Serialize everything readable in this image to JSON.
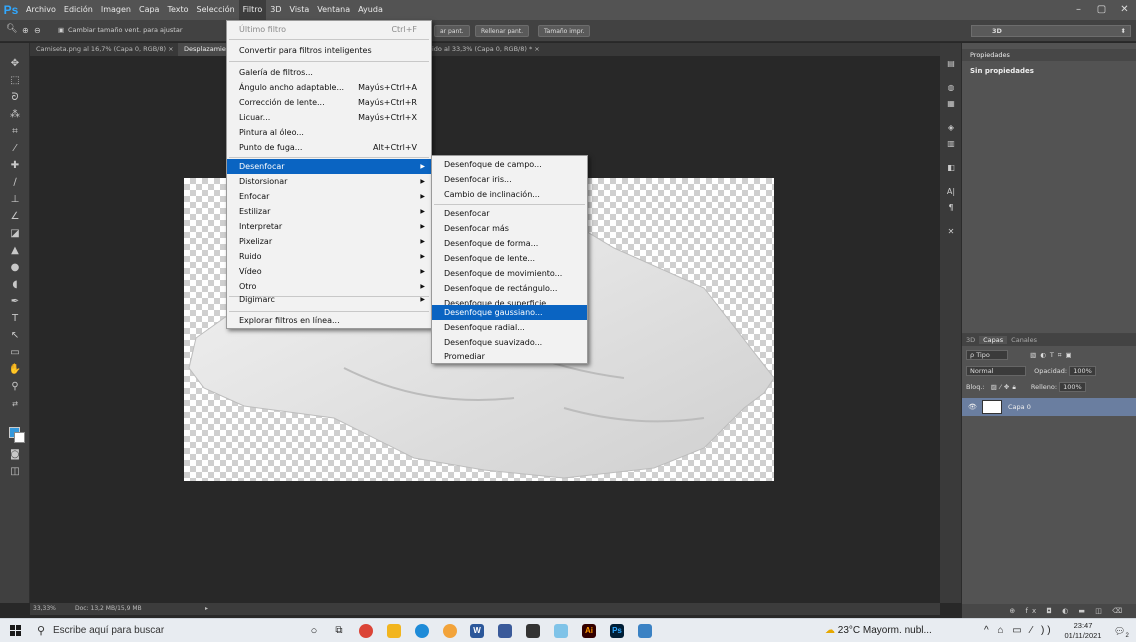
{
  "app": {
    "logo": "Ps"
  },
  "menubar": [
    "Archivo",
    "Edición",
    "Imagen",
    "Capa",
    "Texto",
    "Selección",
    "Filtro",
    "3D",
    "Vista",
    "Ventana",
    "Ayuda"
  ],
  "window_controls": [
    "–",
    "▢",
    "✕"
  ],
  "options": {
    "fit_window": "Cambiar tamaño vent. para ajustar",
    "btn_fill_screen_a": "ar pant.",
    "btn_fill_screen": "Rellenar pant.",
    "btn_print_size": "Tamaño impr.",
    "workspace": "3D"
  },
  "tabs": [
    {
      "label": "Camiseta.png al 16,7% (Capa 0, RGB/8) ×"
    },
    {
      "label": "Desplazamie"
    },
    {
      "label": "ido al 33,3% (Capa 0, RGB/8) * ×"
    }
  ],
  "filter_menu": {
    "last_filter": "Último filtro",
    "last_filter_sc": "Ctrl+F",
    "smart": "Convertir para filtros inteligentes",
    "gallery": "Galería de filtros...",
    "wide_angle": "Ángulo ancho adaptable...",
    "wide_angle_sc": "Mayús+Ctrl+A",
    "lens_corr": "Corrección de lente...",
    "lens_corr_sc": "Mayús+Ctrl+R",
    "liquify": "Licuar...",
    "liquify_sc": "Mayús+Ctrl+X",
    "oil": "Pintura al óleo...",
    "vanishing": "Punto de fuga...",
    "vanishing_sc": "Alt+Ctrl+V",
    "blur": "Desenfocar",
    "distort": "Distorsionar",
    "sharpen": "Enfocar",
    "stylize": "Estilizar",
    "render": "Interpretar",
    "pixelate": "Pixelizar",
    "noise": "Ruido",
    "video": "Vídeo",
    "other": "Otro",
    "digimarc": "Digimarc",
    "browse": "Explorar filtros en línea..."
  },
  "blur_menu": {
    "field": "Desenfoque de campo...",
    "iris": "Desenfocar iris...",
    "tilt": "Cambio de inclinación...",
    "blur": "Desenfocar",
    "blur_more": "Desenfocar más",
    "shape": "Desenfoque de forma...",
    "lens": "Desenfoque de lente...",
    "motion": "Desenfoque de movimiento...",
    "box": "Desenfoque de rectángulo...",
    "surface": "Desenfoque de superficie...",
    "gaussian": "Desenfoque gaussiano...",
    "radial": "Desenfoque radial...",
    "smart": "Desenfoque suavizado...",
    "average": "Promediar"
  },
  "status": {
    "zoom": "33,33%",
    "doc": "Doc: 13,2 MB/15,9 MB",
    "arrow": "▸"
  },
  "properties": {
    "title": "Propiedades",
    "value": "Sin propiedades"
  },
  "layers_panel": {
    "tabs": [
      "3D",
      "Capas",
      "Canales"
    ],
    "kind": "ρ Tipo",
    "blend": "Normal",
    "opacity_label": "Opacidad:",
    "opacity": "100%",
    "lock_label": "Bloq.:",
    "fill_label": "Relleno:",
    "fill": "100%",
    "layer_name": "Capa 0",
    "bottom_icons": "⊕ fx ◘ ◐ ▬ ◫ ⌫"
  },
  "taskbar": {
    "search_placeholder": "Escribe aquí para buscar",
    "weather": "23°C  Mayorm. nubl...",
    "tray_icons": "^ ⌂ ▭ ⁄ ))",
    "time": "23:47",
    "date": "01/11/2021",
    "notif": "2"
  }
}
